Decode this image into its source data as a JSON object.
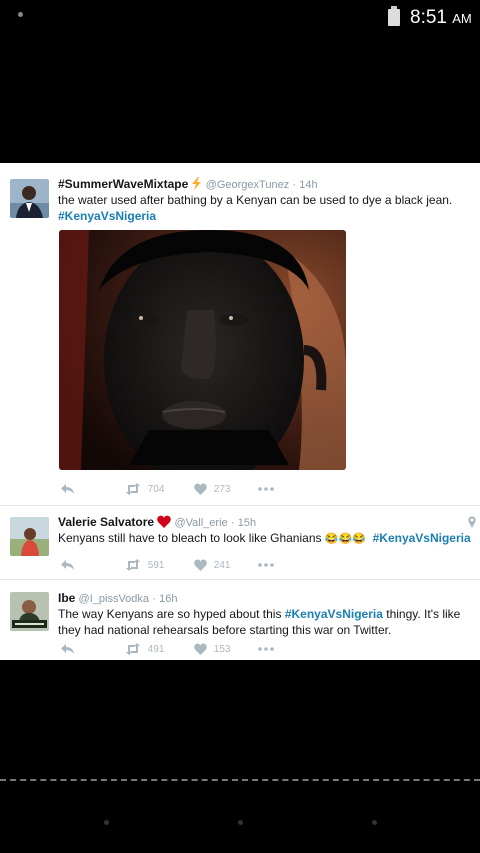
{
  "status_bar": {
    "time": "8:51",
    "ampm": "AM"
  },
  "tweets": [
    {
      "name": "#SummerWaveMixtape",
      "handle": "@GeorgexTunez",
      "sep": "·",
      "time": "14h",
      "text": "the water used after bathing by a Kenyan can be used to dye a black jean.",
      "hashtag": "#KenyaVsNigeria",
      "retweets": "704",
      "likes": "273",
      "has_photo": true
    },
    {
      "name": "Valerie Salvatore",
      "handle": "@Vall_erie",
      "sep": "·",
      "time": "15h",
      "text": "Kenyans still have to bleach to look like Ghanians",
      "emoji": "😂😂😂",
      "hashtag": "#KenyaVsNigeria",
      "retweets": "591",
      "likes": "241"
    },
    {
      "name": "Ibe",
      "handle": "@I_pissVodka",
      "sep": "·",
      "time": "16h",
      "text_before": "The way Kenyans are so hyped about this",
      "hashtag": "#KenyaVsNigeria",
      "text_after": "thingy. It's like they had national rehearsals before starting this war on Twitter.",
      "retweets": "491",
      "likes": "153"
    }
  ],
  "colors": {
    "hashtag": "#1a7fb3",
    "handle": "#8899a6",
    "action": "#aab8c2",
    "heart": "#e0245e",
    "lightning": "#ffac33"
  },
  "icons": [
    "reply-icon",
    "retweet-icon",
    "like-icon",
    "more-icon",
    "lightning-icon",
    "heart-emoji-icon",
    "location-icon"
  ]
}
